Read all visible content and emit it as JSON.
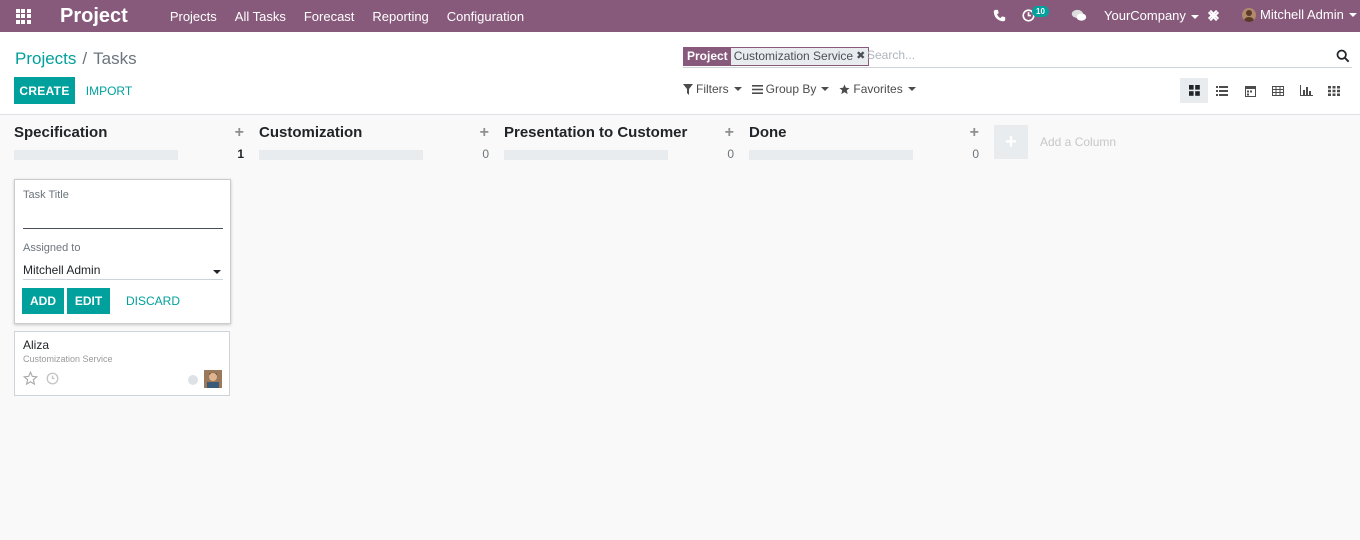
{
  "navbar": {
    "app_title": "Project",
    "menu": [
      "Projects",
      "All Tasks",
      "Forecast",
      "Reporting",
      "Configuration"
    ],
    "activity_badge": "10",
    "company": "YourCompany",
    "user": "Mitchell Admin",
    "color": "#875a7b"
  },
  "breadcrumb": {
    "parent": "Projects",
    "separator": "/",
    "current": "Tasks"
  },
  "search": {
    "facet_label": "Project",
    "facet_value": "Customization Service",
    "placeholder": "Search..."
  },
  "buttons": {
    "create": "CREATE",
    "import": "IMPORT"
  },
  "filters": {
    "filters": "Filters",
    "group_by": "Group By",
    "favorites": "Favorites"
  },
  "views": [
    "kanban",
    "list",
    "calendar",
    "pivot",
    "graph",
    "grid"
  ],
  "columns": [
    {
      "title": "Specification",
      "count": "1",
      "progress_pct": 0
    },
    {
      "title": "Customization",
      "count": "0",
      "progress_pct": 0
    },
    {
      "title": "Presentation to Customer",
      "count": "0",
      "progress_pct": 0
    },
    {
      "title": "Done",
      "count": "0",
      "progress_pct": 0
    }
  ],
  "quick_create": {
    "task_title_label": "Task Title",
    "assigned_label": "Assigned to",
    "assigned_value": "Mitchell Admin",
    "add": "ADD",
    "edit": "EDIT",
    "discard": "DISCARD"
  },
  "card": {
    "title": "Aliza",
    "project": "Customization Service"
  },
  "add_column": "Add a Column",
  "accent_color": "#00a09d"
}
